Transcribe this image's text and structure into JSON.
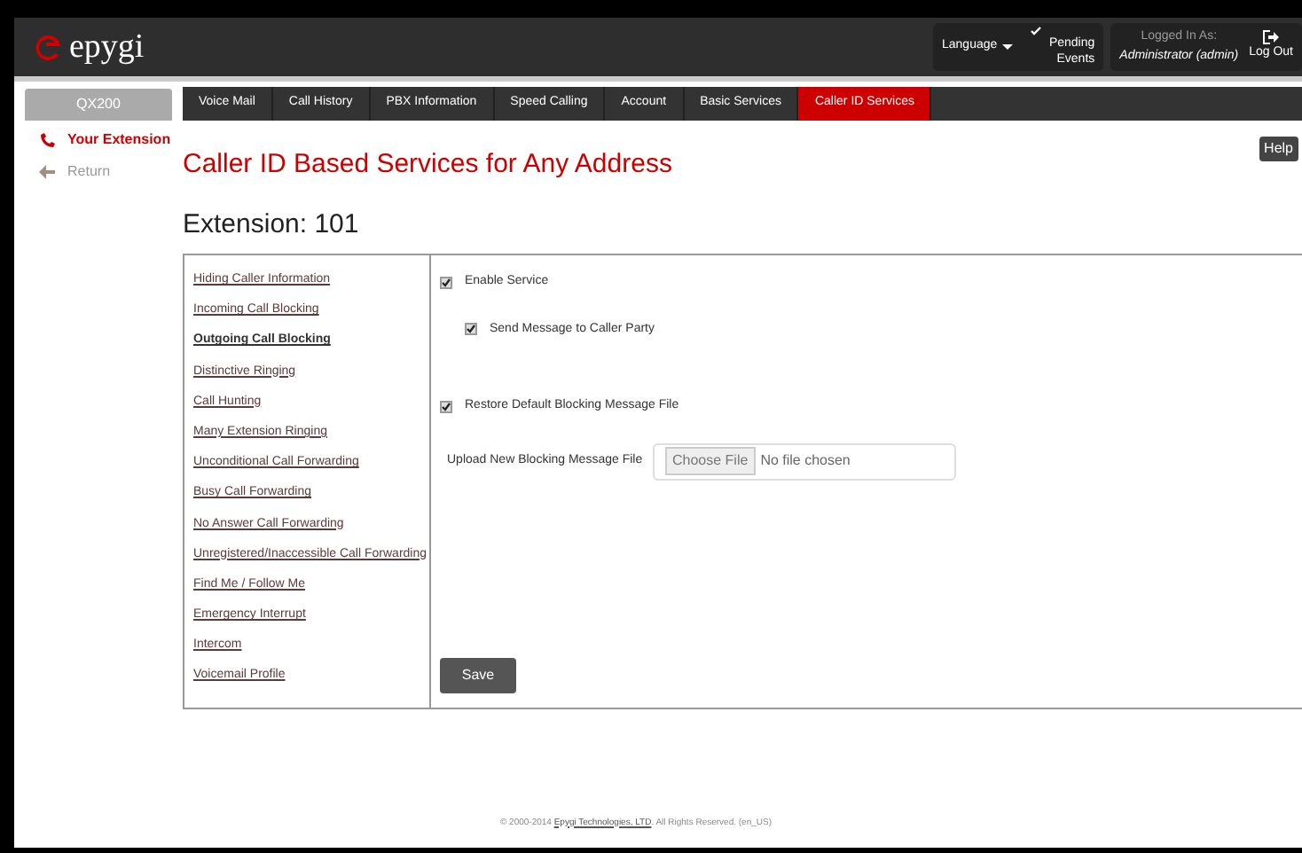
{
  "header": {
    "logo": "epygi",
    "language": "Language",
    "pending": "Pending Events",
    "logged_in_label": "Logged In As:",
    "user": "Administrator (admin)",
    "logout": "Log Out"
  },
  "device": "QX200",
  "tabs": [
    {
      "label": "Voice Mail",
      "selected": false
    },
    {
      "label": "Call History",
      "selected": false
    },
    {
      "label": "PBX Information",
      "selected": false
    },
    {
      "label": "Speed Calling",
      "selected": false
    },
    {
      "label": "Account",
      "selected": false
    },
    {
      "label": "Basic Services",
      "selected": false
    },
    {
      "label": "Caller ID Services",
      "selected": true
    }
  ],
  "side_nav": [
    {
      "label": "Your Extension",
      "kind": "phone",
      "selected": true
    },
    {
      "label": "Return",
      "kind": "back",
      "selected": false
    }
  ],
  "help": "Help",
  "title": "Caller ID Based Services for Any Address",
  "subtitle": "Extension: 101",
  "services": [
    {
      "label": "Hiding Caller Information",
      "selected": false
    },
    {
      "label": "Incoming Call Blocking",
      "selected": false
    },
    {
      "label": "Outgoing Call Blocking",
      "selected": true
    },
    {
      "label": "Distinctive Ringing",
      "selected": false
    },
    {
      "label": "Call Hunting",
      "selected": false
    },
    {
      "label": "Many Extension Ringing",
      "selected": false
    },
    {
      "label": "Unconditional Call Forwarding",
      "selected": false
    },
    {
      "label": "Busy Call Forwarding",
      "selected": false
    },
    {
      "label": "No Answer Call Forwarding",
      "selected": false
    },
    {
      "label": "Unregistered/Inaccessible Call Forwarding",
      "selected": false
    },
    {
      "label": "Find Me / Follow Me",
      "selected": false
    },
    {
      "label": "Emergency Interrupt",
      "selected": false
    },
    {
      "label": "Intercom",
      "selected": false
    },
    {
      "label": "Voicemail Profile",
      "selected": false
    }
  ],
  "form": [
    {
      "kind": "checkbox",
      "label": "Enable Service",
      "checked": true,
      "indented": false
    },
    {
      "kind": "checkbox",
      "label": "Send Message to Caller Party",
      "checked": true,
      "indented": true
    },
    {
      "kind": "checkbox",
      "label": "Restore Default Blocking Message File",
      "checked": true,
      "indented": false
    },
    {
      "kind": "file",
      "label": "Upload New Blocking Message File",
      "button": "Choose File",
      "value": "No file chosen"
    }
  ],
  "save": "Save",
  "footer": {
    "prefix": "© 2000-2014 ",
    "link": "Epygi Technologies, LTD",
    "suffix": ". All Rights Reserved. (en_US)"
  }
}
